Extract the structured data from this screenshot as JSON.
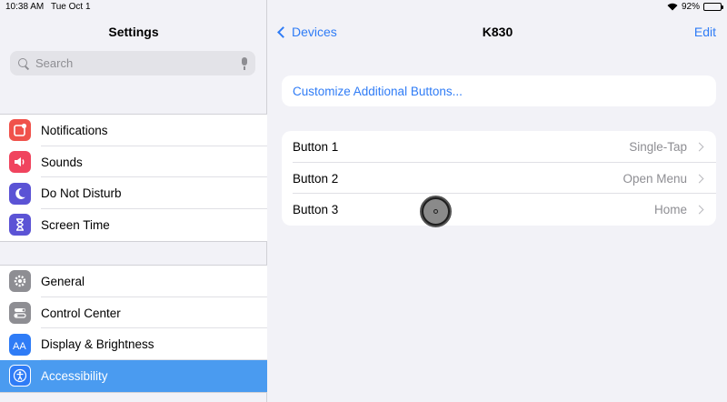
{
  "status_bar": {
    "time": "10:38 AM",
    "date": "Tue Oct 1",
    "battery": "92%",
    "battery_level": 0.92
  },
  "sidebar": {
    "title": "Settings",
    "search": {
      "placeholder": "Search"
    },
    "group1": [
      {
        "label": "Notifications",
        "icon": "notifications-icon",
        "color": "#f0524b"
      },
      {
        "label": "Sounds",
        "icon": "sounds-icon",
        "color": "#f0445e"
      },
      {
        "label": "Do Not Disturb",
        "icon": "moon-icon",
        "color": "#5b53d5"
      },
      {
        "label": "Screen Time",
        "icon": "hourglass-icon",
        "color": "#5b53d5"
      }
    ],
    "group2": [
      {
        "label": "General",
        "icon": "gear-icon",
        "color": "#8e8e93"
      },
      {
        "label": "Control Center",
        "icon": "toggles-icon",
        "color": "#8e8e93"
      },
      {
        "label": "Display & Brightness",
        "icon": "text-size-icon",
        "color": "#2f7cf6"
      },
      {
        "label": "Accessibility",
        "icon": "accessibility-icon",
        "color": "#2f7cf6",
        "selected": true
      }
    ]
  },
  "detail": {
    "back_label": "Devices",
    "title": "K830",
    "edit_label": "Edit",
    "customize_label": "Customize Additional Buttons...",
    "buttons": [
      {
        "label": "Button 1",
        "value": "Single-Tap"
      },
      {
        "label": "Button 2",
        "value": "Open Menu"
      },
      {
        "label": "Button 3",
        "value": "Home"
      }
    ]
  },
  "colors": {
    "accent": "#2f7cf6",
    "selected_row": "#4a9bf0"
  }
}
